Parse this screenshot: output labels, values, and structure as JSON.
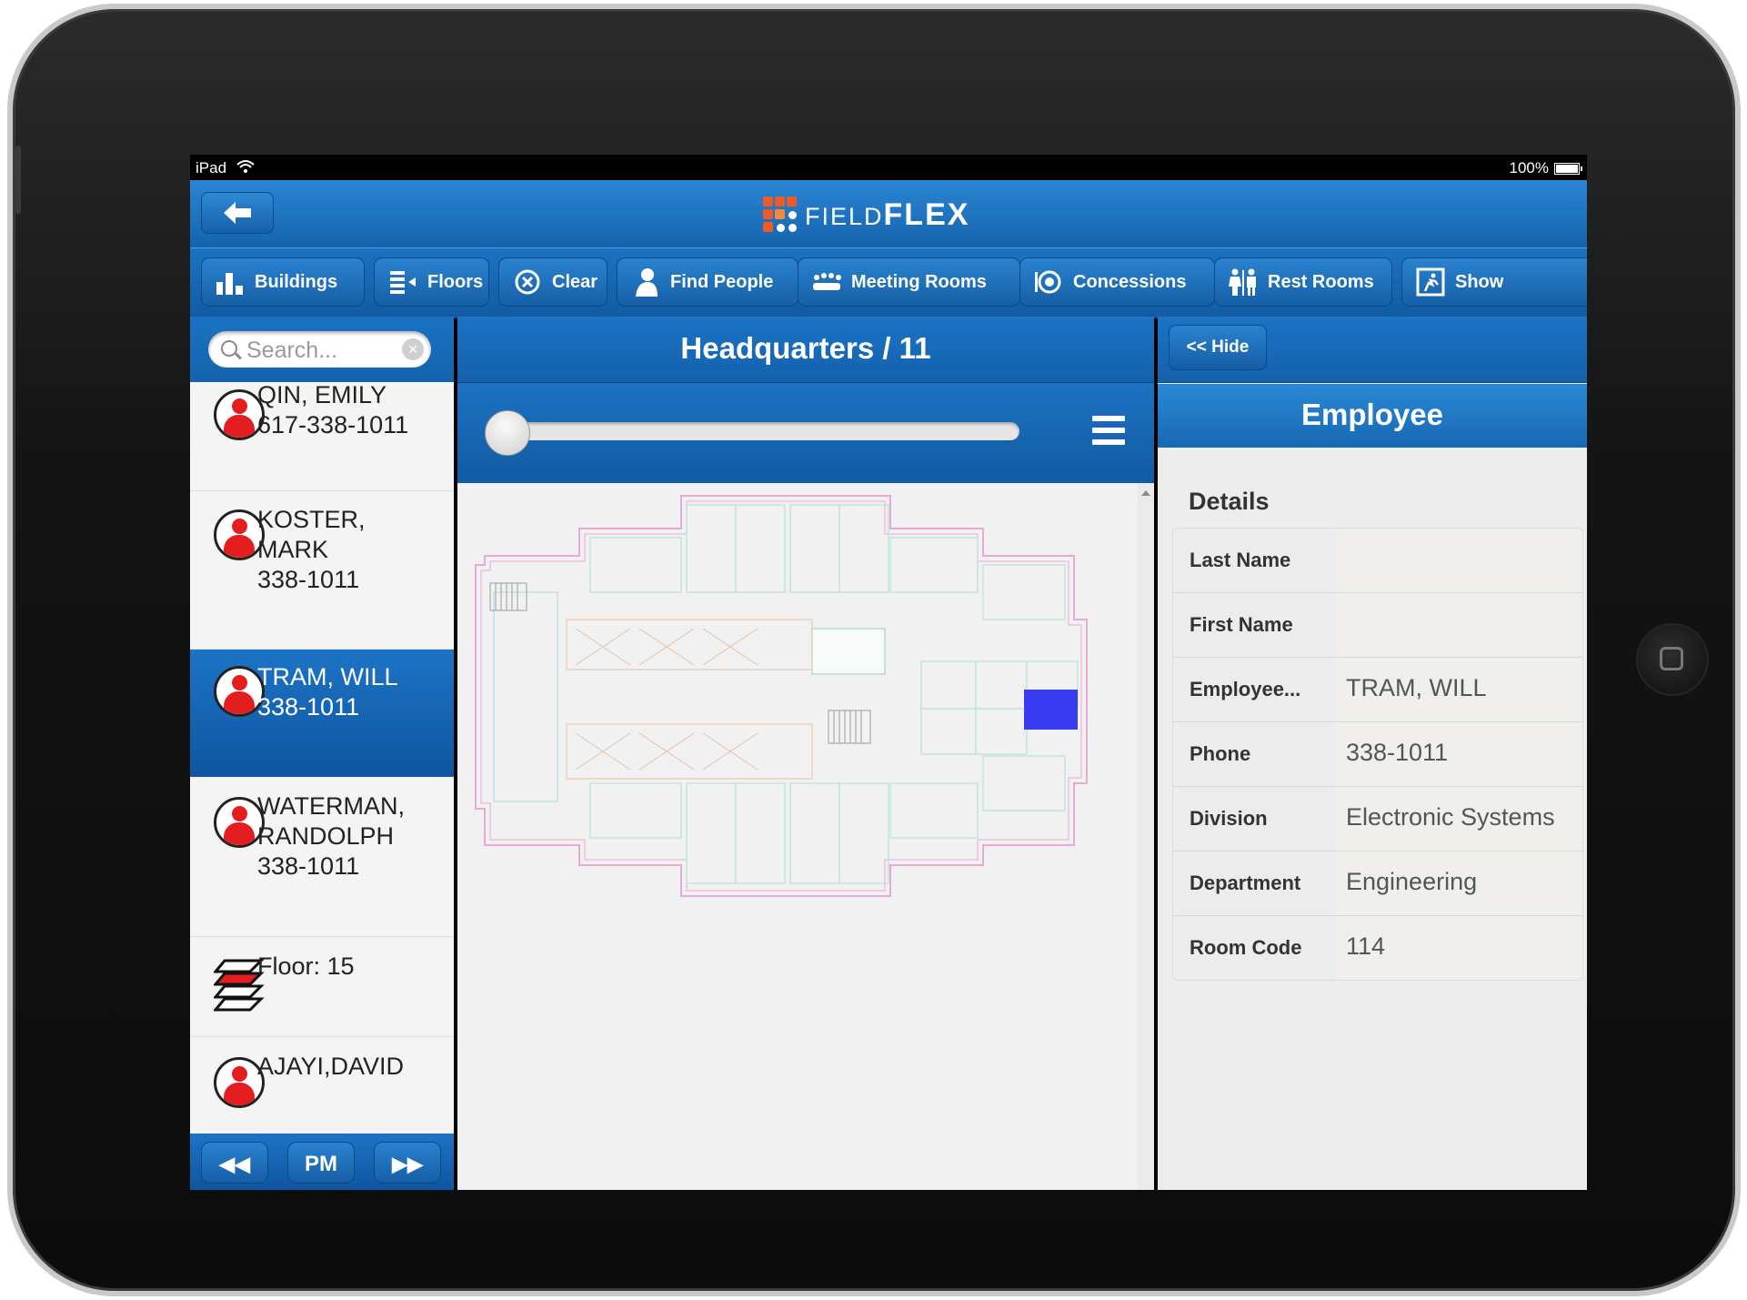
{
  "device": {
    "status_left": "iPad",
    "status_right": "100%"
  },
  "header": {
    "back_icon": "back-arrow-icon",
    "logo_small": "FIELD",
    "logo_big": "FLEX"
  },
  "toolbar": [
    {
      "label": "Buildings",
      "icon": "buildings-icon"
    },
    {
      "label": "Floors",
      "icon": "floors-icon"
    },
    {
      "label": "Clear",
      "icon": "clear-icon"
    },
    {
      "label": "Find People",
      "icon": "person-icon"
    },
    {
      "label": "Meeting Rooms",
      "icon": "meeting-rooms-icon"
    },
    {
      "label": "Concessions",
      "icon": "concessions-icon"
    },
    {
      "label": "Rest Rooms",
      "icon": "restroom-icon"
    },
    {
      "label": "Show",
      "icon": "show-icon"
    }
  ],
  "search": {
    "placeholder": "Search..."
  },
  "list": [
    {
      "line1": "QIN, EMILY",
      "line2": "617-338-1011",
      "line3": ""
    },
    {
      "line1": "KOSTER,",
      "line2": "MARK",
      "line3": "338-1011"
    },
    {
      "line1": "TRAM, WILL",
      "line2": "338-1011",
      "line3": ""
    },
    {
      "line1": "WATERMAN,",
      "line2": "RANDOLPH",
      "line3": "338-1011"
    },
    {
      "line1": "Floor: 15",
      "line2": "",
      "line3": ""
    },
    {
      "line1": "AJAYI,DAVID",
      "line2": "",
      "line3": ""
    }
  ],
  "list_selected_index": 2,
  "pager": {
    "prev": "◀◀",
    "middle": "PM",
    "next": "▶▶"
  },
  "center": {
    "title": "Headquarters / 11",
    "slider_position": 0
  },
  "right": {
    "hide_label": "<< Hide",
    "title": "Employee",
    "details_label": "Details",
    "rows": [
      {
        "key": "Last Name",
        "value": ""
      },
      {
        "key": "First Name",
        "value": ""
      },
      {
        "key": "Employee...",
        "value": "TRAM, WILL"
      },
      {
        "key": "Phone",
        "value": "338-1011"
      },
      {
        "key": "Division",
        "value": "Electronic Systems"
      },
      {
        "key": "Department",
        "value": "Engineering"
      },
      {
        "key": "Room Code",
        "value": "114"
      }
    ]
  },
  "colors": {
    "accent": "#1563ad",
    "highlight": "#3a3af0",
    "person": "#e41e1e"
  }
}
